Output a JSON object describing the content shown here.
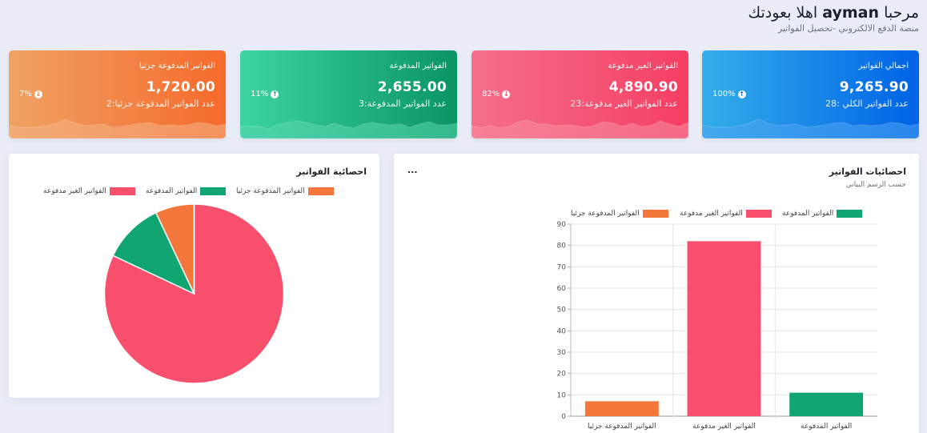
{
  "header": {
    "greeting": "مرحبا",
    "username": "ayman",
    "welcome_back": "اهلا بعودتك",
    "subtitle": "منصة الدفع الالكتروني -تحصيل الفواتير"
  },
  "cards": [
    {
      "title": "اجمالي الفواتير",
      "amount": "9,265.90",
      "count": "عدد الفواتير الكلي :28",
      "percent": "100%",
      "direction": "up",
      "gradient": [
        "#0062e6",
        "#33aeea"
      ],
      "spark_color": "#4fa4f0"
    },
    {
      "title": "الفواتير الغير مدفوعة",
      "amount": "4,890.90",
      "count": "عدد الفواتير الغير مدفوعة:23",
      "percent": "82%",
      "direction": "down",
      "gradient": [
        "#f43e63",
        "#f56f8b"
      ],
      "spark_color": "#f78ea3"
    },
    {
      "title": "الفواتير المدفوعة",
      "amount": "2,655.00",
      "count": "عدد الفواتير المدفوعة:3",
      "percent": "11%",
      "direction": "up",
      "gradient": [
        "#0a9463",
        "#3dd4a3"
      ],
      "spark_color": "#5ad7ae"
    },
    {
      "title": "الفواتير المدفوعة جزئيا",
      "amount": "1,720.00",
      "count": "عدد الفواتير المدفوعة جزئيا:2",
      "percent": "7%",
      "direction": "down",
      "gradient": [
        "#f56a2c",
        "#f0a263"
      ],
      "spark_color": "#f5b488"
    }
  ],
  "bar_panel": {
    "title": "احصائيات الفواتير",
    "subtitle": "حسب الرسم البياني",
    "menu": "..."
  },
  "pie_panel": {
    "title": "احصائية الفواتير"
  },
  "colors": {
    "unpaid": "#f84f6d",
    "paid": "#10a571",
    "partial": "#f3773a"
  },
  "chart_data": [
    {
      "type": "bar",
      "categories": [
        "الفواتير المدفوعة جزئيا",
        "الفواتير الغير مدفوعة",
        "الفواتير المدفوعة"
      ],
      "series": [
        {
          "name": "الفواتير المدفوعة جزئيا",
          "values": [
            7,
            0,
            0
          ]
        },
        {
          "name": "الفواتير الغير مدفوعة",
          "values": [
            0,
            82,
            0
          ]
        },
        {
          "name": "الفواتير المدفوعة",
          "values": [
            0,
            0,
            11
          ]
        }
      ],
      "values": [
        7,
        82,
        11
      ],
      "ylim": [
        0,
        90
      ],
      "yticks": [
        0,
        10,
        20,
        30,
        40,
        50,
        60,
        70,
        80,
        90
      ],
      "legend": [
        "الفواتير المدفوعة جزئيا",
        "الفواتير الغير مدفوعة",
        "الفواتير المدفوعة"
      ],
      "legend_position": "top",
      "grid": true
    },
    {
      "type": "pie",
      "labels": [
        "الفواتير الغير مدفوعة",
        "الفواتير المدفوعة",
        "الفواتير المدفوعة جزئيا"
      ],
      "values": [
        82,
        11,
        7
      ],
      "legend_position": "top"
    }
  ]
}
